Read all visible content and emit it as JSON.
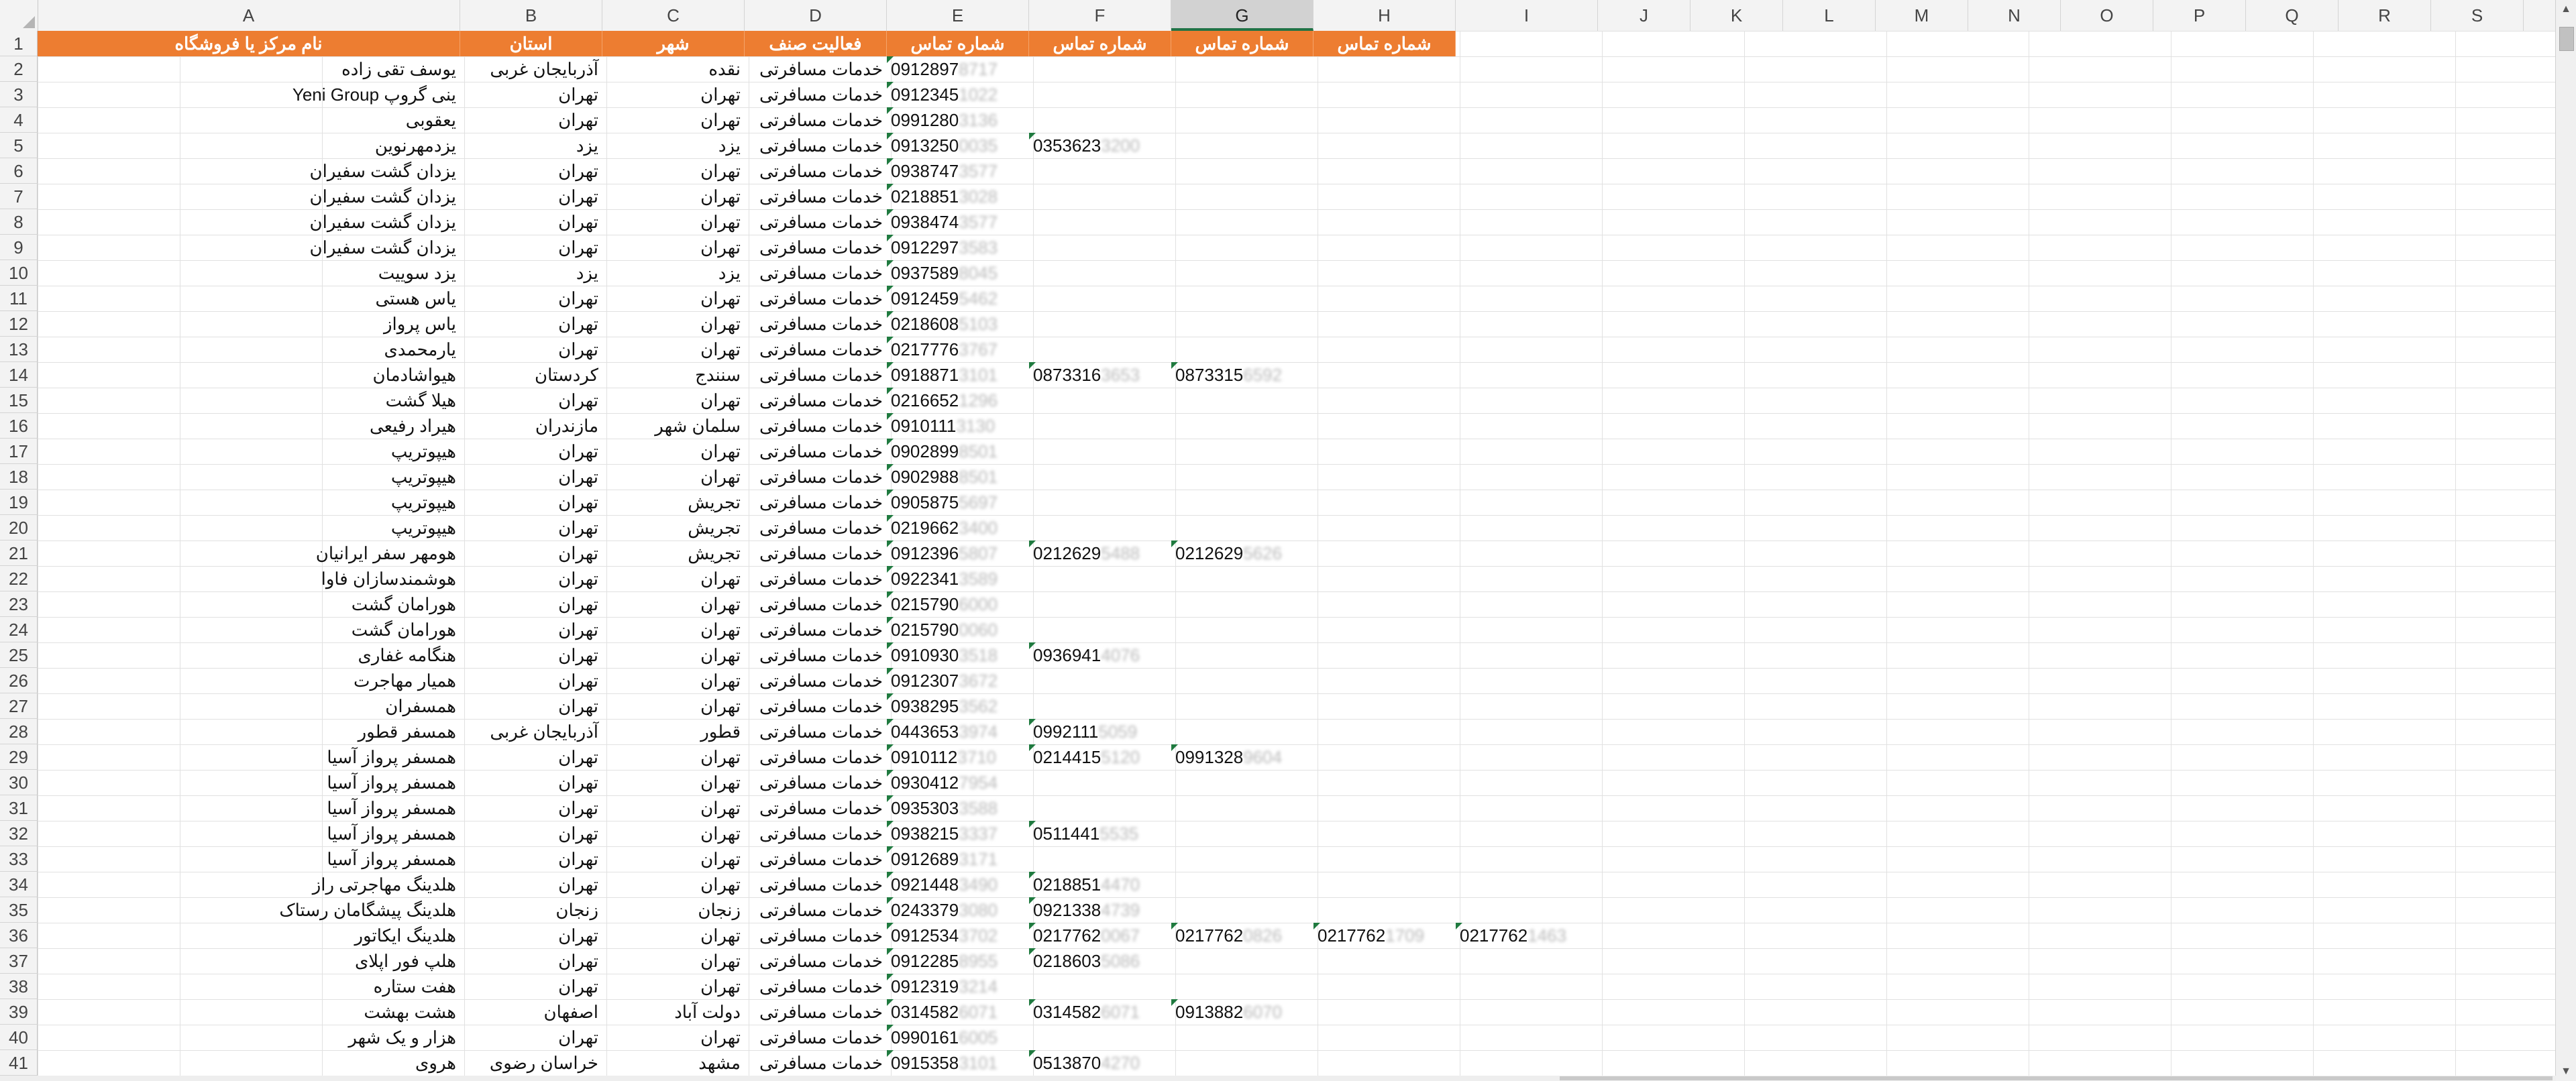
{
  "columns": [
    "A",
    "B",
    "C",
    "D",
    "E",
    "F",
    "G",
    "H",
    "I",
    "J",
    "K",
    "L",
    "M",
    "N",
    "O",
    "P",
    "Q",
    "R",
    "S"
  ],
  "selected_column": "G",
  "header": {
    "row_number": "1",
    "A": "نام مرکز یا فروشگاه",
    "B": "استان",
    "C": "شهر",
    "D": "فعالیت صنف",
    "E": "شماره تماس",
    "F": "شماره تماس",
    "G": "شماره تماس",
    "H": "شماره تماس"
  },
  "rows": [
    {
      "n": "2",
      "a": "یوسف تقی زاده",
      "b": "آذربایجان غربی",
      "c": "نقده",
      "d": "خدمات مسافرتی",
      "e": "0912897",
      "eh": "8717",
      "f": "",
      "fh": "",
      "g": "",
      "gh": "",
      "h": "",
      "hh": "",
      "i": "",
      "ih": ""
    },
    {
      "n": "3",
      "a": "ینی گروپ Yeni Group",
      "b": "تهران",
      "c": "تهران",
      "d": "خدمات مسافرتی",
      "e": "0912345",
      "eh": "1022",
      "f": "",
      "fh": "",
      "g": "",
      "gh": "",
      "h": "",
      "hh": "",
      "i": "",
      "ih": ""
    },
    {
      "n": "4",
      "a": "یعقوبی",
      "b": "تهران",
      "c": "تهران",
      "d": "خدمات مسافرتی",
      "e": "0991280",
      "eh": "3136",
      "f": "",
      "fh": "",
      "g": "",
      "gh": "",
      "h": "",
      "hh": "",
      "i": "",
      "ih": ""
    },
    {
      "n": "5",
      "a": "یزدمهرنوین",
      "b": "یزد",
      "c": "یزد",
      "d": "خدمات مسافرتی",
      "e": "0913250",
      "eh": "0035",
      "f": "0353623",
      "fh": "3200",
      "g": "",
      "gh": "",
      "h": "",
      "hh": "",
      "i": "",
      "ih": ""
    },
    {
      "n": "6",
      "a": "یزدان گشت سفیران",
      "b": "تهران",
      "c": "تهران",
      "d": "خدمات مسافرتی",
      "e": "0938747",
      "eh": "3577",
      "f": "",
      "fh": "",
      "g": "",
      "gh": "",
      "h": "",
      "hh": "",
      "i": "",
      "ih": ""
    },
    {
      "n": "7",
      "a": "یزدان گشت سفیران",
      "b": "تهران",
      "c": "تهران",
      "d": "خدمات مسافرتی",
      "e": "0218851",
      "eh": "3028",
      "f": "",
      "fh": "",
      "g": "",
      "gh": "",
      "h": "",
      "hh": "",
      "i": "",
      "ih": ""
    },
    {
      "n": "8",
      "a": "یزدان گشت سفیران",
      "b": "تهران",
      "c": "تهران",
      "d": "خدمات مسافرتی",
      "e": "0938474",
      "eh": "3577",
      "f": "",
      "fh": "",
      "g": "",
      "gh": "",
      "h": "",
      "hh": "",
      "i": "",
      "ih": ""
    },
    {
      "n": "9",
      "a": "یزدان گشت سفیران",
      "b": "تهران",
      "c": "تهران",
      "d": "خدمات مسافرتی",
      "e": "0912297",
      "eh": "3583",
      "f": "",
      "fh": "",
      "g": "",
      "gh": "",
      "h": "",
      "hh": "",
      "i": "",
      "ih": ""
    },
    {
      "n": "10",
      "a": "یزد سوییت",
      "b": "یزد",
      "c": "یزد",
      "d": "خدمات مسافرتی",
      "e": "0937589",
      "eh": "8045",
      "f": "",
      "fh": "",
      "g": "",
      "gh": "",
      "h": "",
      "hh": "",
      "i": "",
      "ih": ""
    },
    {
      "n": "11",
      "a": "یاس هستی",
      "b": "تهران",
      "c": "تهران",
      "d": "خدمات مسافرتی",
      "e": "0912459",
      "eh": "5462",
      "f": "",
      "fh": "",
      "g": "",
      "gh": "",
      "h": "",
      "hh": "",
      "i": "",
      "ih": ""
    },
    {
      "n": "12",
      "a": "یاس پرواز",
      "b": "تهران",
      "c": "تهران",
      "d": "خدمات مسافرتی",
      "e": "0218608",
      "eh": "5103",
      "f": "",
      "fh": "",
      "g": "",
      "gh": "",
      "h": "",
      "hh": "",
      "i": "",
      "ih": ""
    },
    {
      "n": "13",
      "a": "یارمحمدی",
      "b": "تهران",
      "c": "تهران",
      "d": "خدمات مسافرتی",
      "e": "0217776",
      "eh": "3767",
      "f": "",
      "fh": "",
      "g": "",
      "gh": "",
      "h": "",
      "hh": "",
      "i": "",
      "ih": ""
    },
    {
      "n": "14",
      "a": "هیواشادمان",
      "b": "کردستان",
      "c": "سنندج",
      "d": "خدمات مسافرتی",
      "e": "0918871",
      "eh": "3101",
      "f": "0873316",
      "fh": "3653",
      "g": "0873315",
      "gh": "6592",
      "h": "",
      "hh": "",
      "i": "",
      "ih": ""
    },
    {
      "n": "15",
      "a": "هیلا گشت",
      "b": "تهران",
      "c": "تهران",
      "d": "خدمات مسافرتی",
      "e": "0216652",
      "eh": "1296",
      "f": "",
      "fh": "",
      "g": "",
      "gh": "",
      "h": "",
      "hh": "",
      "i": "",
      "ih": ""
    },
    {
      "n": "16",
      "a": "هیراد رفیعی",
      "b": "مازندران",
      "c": "سلمان شهر",
      "d": "خدمات مسافرتی",
      "e": "0910111",
      "eh": "3130",
      "f": "",
      "fh": "",
      "g": "",
      "gh": "",
      "h": "",
      "hh": "",
      "i": "",
      "ih": ""
    },
    {
      "n": "17",
      "a": "هیپوتریپ",
      "b": "تهران",
      "c": "تهران",
      "d": "خدمات مسافرتی",
      "e": "0902899",
      "eh": "8501",
      "f": "",
      "fh": "",
      "g": "",
      "gh": "",
      "h": "",
      "hh": "",
      "i": "",
      "ih": ""
    },
    {
      "n": "18",
      "a": "هیپوتریپ",
      "b": "تهران",
      "c": "تهران",
      "d": "خدمات مسافرتی",
      "e": "0902988",
      "eh": "8501",
      "f": "",
      "fh": "",
      "g": "",
      "gh": "",
      "h": "",
      "hh": "",
      "i": "",
      "ih": ""
    },
    {
      "n": "19",
      "a": "هیپوتریپ",
      "b": "تهران",
      "c": "تجریش",
      "d": "خدمات مسافرتی",
      "e": "0905875",
      "eh": "5697",
      "f": "",
      "fh": "",
      "g": "",
      "gh": "",
      "h": "",
      "hh": "",
      "i": "",
      "ih": ""
    },
    {
      "n": "20",
      "a": "هیپوتریپ",
      "b": "تهران",
      "c": "تجریش",
      "d": "خدمات مسافرتی",
      "e": "0219662",
      "eh": "3400",
      "f": "",
      "fh": "",
      "g": "",
      "gh": "",
      "h": "",
      "hh": "",
      "i": "",
      "ih": ""
    },
    {
      "n": "21",
      "a": "هومهر سفر ایرانیان",
      "b": "تهران",
      "c": "تجریش",
      "d": "خدمات مسافرتی",
      "e": "0912396",
      "eh": "5807",
      "f": "0212629",
      "fh": "5488",
      "g": "0212629",
      "gh": "5626",
      "h": "",
      "hh": "",
      "i": "",
      "ih": ""
    },
    {
      "n": "22",
      "a": "هوشمندسازان فاوا",
      "b": "تهران",
      "c": "تهران",
      "d": "خدمات مسافرتی",
      "e": "0922341",
      "eh": "3589",
      "f": "",
      "fh": "",
      "g": "",
      "gh": "",
      "h": "",
      "hh": "",
      "i": "",
      "ih": ""
    },
    {
      "n": "23",
      "a": "هورامان گشت",
      "b": "تهران",
      "c": "تهران",
      "d": "خدمات مسافرتی",
      "e": "0215790",
      "eh": "6000",
      "f": "",
      "fh": "",
      "g": "",
      "gh": "",
      "h": "",
      "hh": "",
      "i": "",
      "ih": ""
    },
    {
      "n": "24",
      "a": "هورامان گشت",
      "b": "تهران",
      "c": "تهران",
      "d": "خدمات مسافرتی",
      "e": "0215790",
      "eh": "0060",
      "f": "",
      "fh": "",
      "g": "",
      "gh": "",
      "h": "",
      "hh": "",
      "i": "",
      "ih": ""
    },
    {
      "n": "25",
      "a": "هنگامه غفاری",
      "b": "تهران",
      "c": "تهران",
      "d": "خدمات مسافرتی",
      "e": "0910930",
      "eh": "3518",
      "f": "0936941",
      "fh": "4076",
      "g": "",
      "gh": "",
      "h": "",
      "hh": "",
      "i": "",
      "ih": ""
    },
    {
      "n": "26",
      "a": "همیار مهاجرت",
      "b": "تهران",
      "c": "تهران",
      "d": "خدمات مسافرتی",
      "e": "0912307",
      "eh": "3672",
      "f": "",
      "fh": "",
      "g": "",
      "gh": "",
      "h": "",
      "hh": "",
      "i": "",
      "ih": ""
    },
    {
      "n": "27",
      "a": "همسفران",
      "b": "تهران",
      "c": "تهران",
      "d": "خدمات مسافرتی",
      "e": "0938295",
      "eh": "3562",
      "f": "",
      "fh": "",
      "g": "",
      "gh": "",
      "h": "",
      "hh": "",
      "i": "",
      "ih": ""
    },
    {
      "n": "28",
      "a": "همسفر قطور",
      "b": "آذربایجان غربی",
      "c": "قطور",
      "d": "خدمات مسافرتی",
      "e": "0443653",
      "eh": "3974",
      "f": "0992111",
      "fh": "5059",
      "g": "",
      "gh": "",
      "h": "",
      "hh": "",
      "i": "",
      "ih": ""
    },
    {
      "n": "29",
      "a": "همسفر پرواز آسیا",
      "b": "تهران",
      "c": "تهران",
      "d": "خدمات مسافرتی",
      "e": "0910112",
      "eh": "3710",
      "f": "0214415",
      "fh": "5120",
      "g": "0991328",
      "gh": "9604",
      "h": "",
      "hh": "",
      "i": "",
      "ih": ""
    },
    {
      "n": "30",
      "a": "همسفر پرواز آسیا",
      "b": "تهران",
      "c": "تهران",
      "d": "خدمات مسافرتی",
      "e": "0930412",
      "eh": "7954",
      "f": "",
      "fh": "",
      "g": "",
      "gh": "",
      "h": "",
      "hh": "",
      "i": "",
      "ih": ""
    },
    {
      "n": "31",
      "a": "همسفر پرواز آسیا",
      "b": "تهران",
      "c": "تهران",
      "d": "خدمات مسافرتی",
      "e": "0935303",
      "eh": "3588",
      "f": "",
      "fh": "",
      "g": "",
      "gh": "",
      "h": "",
      "hh": "",
      "i": "",
      "ih": ""
    },
    {
      "n": "32",
      "a": "همسفر پرواز آسیا",
      "b": "تهران",
      "c": "تهران",
      "d": "خدمات مسافرتی",
      "e": "0938215",
      "eh": "3337",
      "f": "0511441",
      "fh": "5535",
      "g": "",
      "gh": "",
      "h": "",
      "hh": "",
      "i": "",
      "ih": ""
    },
    {
      "n": "33",
      "a": "همسفر پرواز آسیا",
      "b": "تهران",
      "c": "تهران",
      "d": "خدمات مسافرتی",
      "e": "0912689",
      "eh": "3171",
      "f": "",
      "fh": "",
      "g": "",
      "gh": "",
      "h": "",
      "hh": "",
      "i": "",
      "ih": ""
    },
    {
      "n": "34",
      "a": "هلدینگ مهاجرتی راز",
      "b": "تهران",
      "c": "تهران",
      "d": "خدمات مسافرتی",
      "e": "0921448",
      "eh": "3490",
      "f": "0218851",
      "fh": "4470",
      "g": "",
      "gh": "",
      "h": "",
      "hh": "",
      "i": "",
      "ih": ""
    },
    {
      "n": "35",
      "a": "هلدینگ پیشگامان رستاک",
      "b": "زنجان",
      "c": "زنجان",
      "d": "خدمات مسافرتی",
      "e": "0243379",
      "eh": "3080",
      "f": "0921338",
      "fh": "4739",
      "g": "",
      "gh": "",
      "h": "",
      "hh": "",
      "i": "",
      "ih": ""
    },
    {
      "n": "36",
      "a": "هلدینگ ایکاتور",
      "b": "تهران",
      "c": "تهران",
      "d": "خدمات مسافرتی",
      "e": "0912534",
      "eh": "3702",
      "f": "0217762",
      "fh": "0067",
      "g": "0217762",
      "gh": "0826",
      "h": "0217762",
      "hh": "1709",
      "i": "0217762",
      "ih": "1463"
    },
    {
      "n": "37",
      "a": "هلپ فور اپلای",
      "b": "تهران",
      "c": "تهران",
      "d": "خدمات مسافرتی",
      "e": "0912285",
      "eh": "8955",
      "f": "0218603",
      "fh": "5086",
      "g": "",
      "gh": "",
      "h": "",
      "hh": "",
      "i": "",
      "ih": ""
    },
    {
      "n": "38",
      "a": "هفت ستاره",
      "b": "تهران",
      "c": "تهران",
      "d": "خدمات مسافرتی",
      "e": "0912319",
      "eh": "3214",
      "f": "",
      "fh": "",
      "g": "",
      "gh": "",
      "h": "",
      "hh": "",
      "i": "",
      "ih": ""
    },
    {
      "n": "39",
      "a": "هشت بهشت",
      "b": "اصفهان",
      "c": "دولت آباد",
      "d": "خدمات مسافرتی",
      "e": "0314582",
      "eh": "6071",
      "f": "0314582",
      "fh": "6071",
      "g": "0913882",
      "gh": "6070",
      "h": "",
      "hh": "",
      "i": "",
      "ih": ""
    },
    {
      "n": "40",
      "a": "هزار و یک شهر",
      "b": "تهران",
      "c": "تهران",
      "d": "خدمات مسافرتی",
      "e": "0990161",
      "eh": "6005",
      "f": "",
      "fh": "",
      "g": "",
      "gh": "",
      "h": "",
      "hh": "",
      "i": "",
      "ih": ""
    },
    {
      "n": "41",
      "a": "هروی",
      "b": "خراسان رضوی",
      "c": "مشهد",
      "d": "خدمات مسافرتی",
      "e": "0915358",
      "eh": "3101",
      "f": "0513870",
      "fh": "4270",
      "g": "",
      "gh": "",
      "h": "",
      "hh": "",
      "i": "",
      "ih": ""
    }
  ]
}
